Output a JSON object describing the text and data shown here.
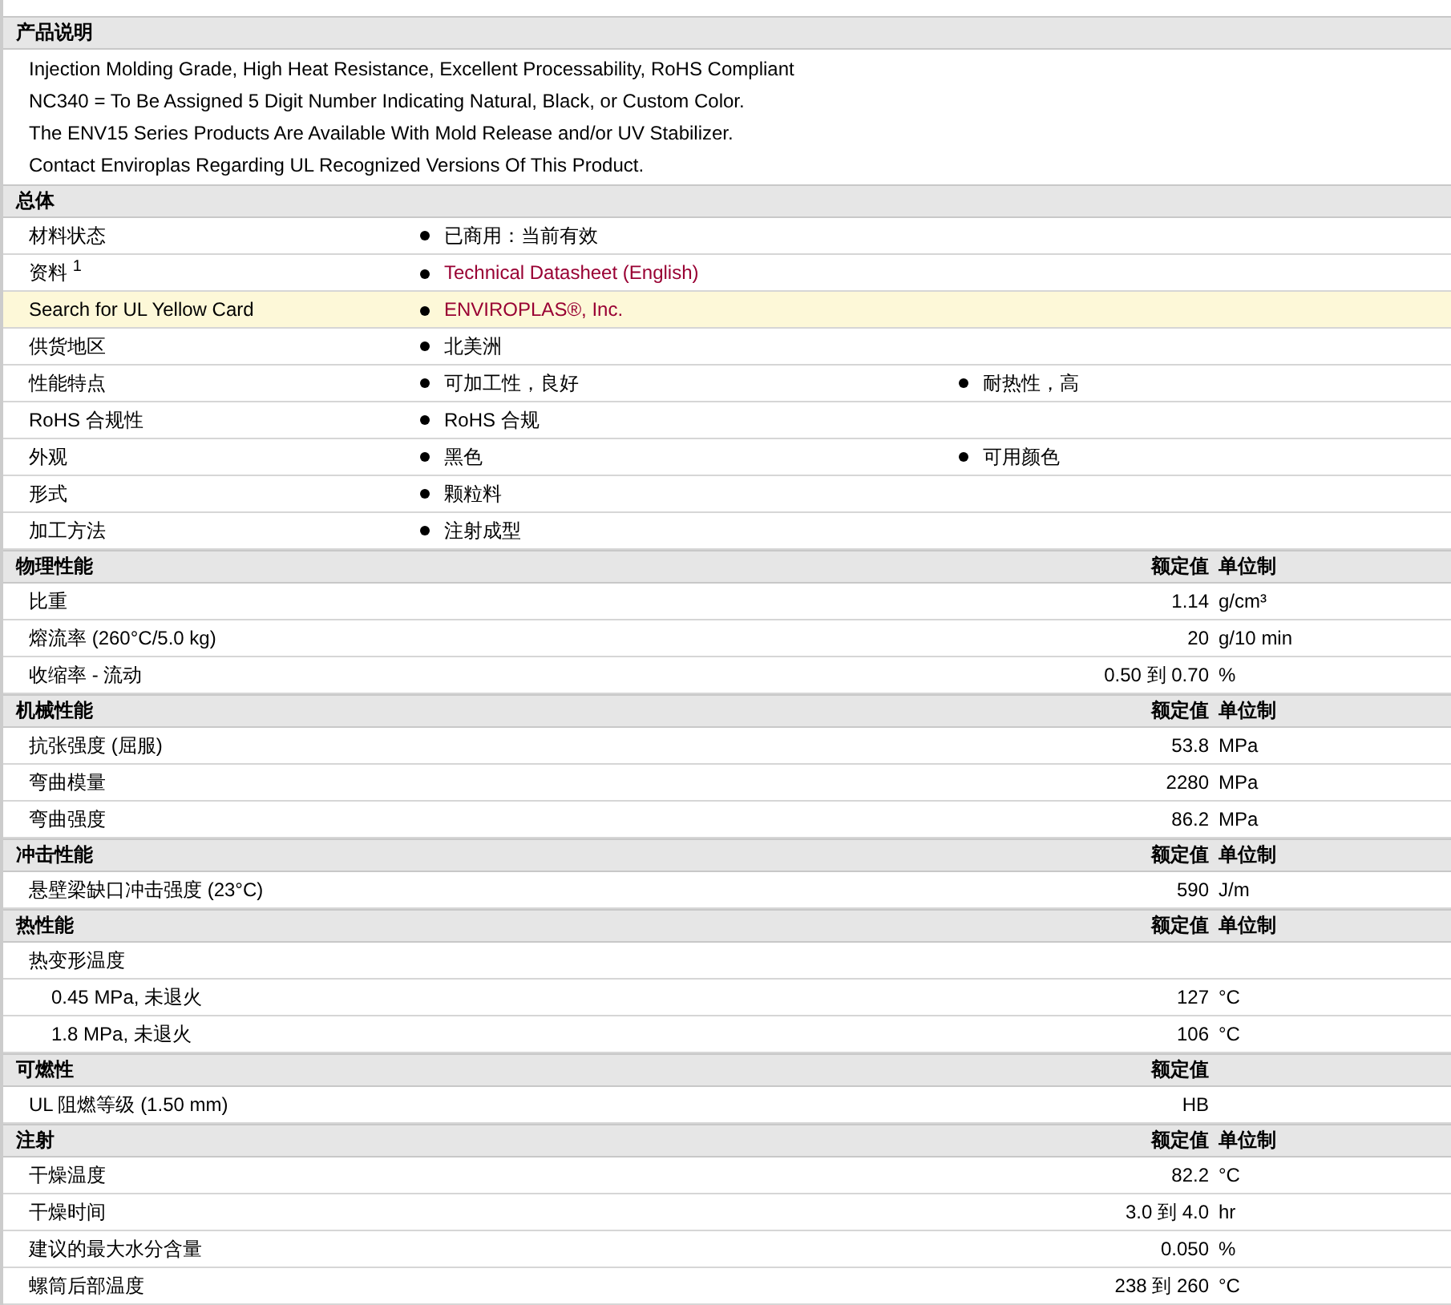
{
  "description": {
    "title": "产品说明",
    "lines": [
      "Injection Molding Grade, High Heat Resistance, Excellent Processability, RoHS Compliant",
      "NC340 = To Be Assigned 5 Digit Number Indicating Natural, Black, or Custom Color.",
      "The ENV15 Series Products Are Available With Mold Release and/or UV Stabilizer.",
      "Contact Enviroplas Regarding UL Recognized Versions Of This Product."
    ]
  },
  "general": {
    "title": "总体",
    "rows": [
      {
        "label": "材料状态",
        "highlighted": false,
        "values": [
          {
            "text": "已商用：当前有效",
            "kind": "text"
          }
        ]
      },
      {
        "label": "资料 $^{1}$",
        "highlighted": false,
        "values": [
          {
            "text": "Technical Datasheet (English)",
            "kind": "link"
          }
        ]
      },
      {
        "label": "Search for UL Yellow Card",
        "highlighted": true,
        "values": [
          {
            "text": "ENVIROPLAS®, Inc.",
            "kind": "link"
          }
        ]
      },
      {
        "label": "供货地区",
        "highlighted": false,
        "values": [
          {
            "text": "北美洲",
            "kind": "text"
          }
        ]
      },
      {
        "label": "性能特点",
        "highlighted": false,
        "values": [
          {
            "text": "可加工性，良好",
            "kind": "text"
          },
          {
            "text": "耐热性，高",
            "kind": "text"
          }
        ]
      },
      {
        "label": "RoHS 合规性",
        "highlighted": false,
        "values": [
          {
            "text": "RoHS 合规",
            "kind": "text"
          }
        ]
      },
      {
        "label": "外观",
        "highlighted": false,
        "values": [
          {
            "text": "黑色",
            "kind": "text"
          },
          {
            "text": "可用颜色",
            "kind": "text"
          }
        ]
      },
      {
        "label": "形式",
        "highlighted": false,
        "values": [
          {
            "text": "颗粒料",
            "kind": "text"
          }
        ]
      },
      {
        "label": "加工方法",
        "highlighted": false,
        "values": [
          {
            "text": "注射成型",
            "kind": "text"
          }
        ]
      }
    ]
  },
  "sections": [
    {
      "title": "物理性能",
      "value_header": "额定值",
      "unit_header": "单位制",
      "rows": [
        {
          "name": "比重",
          "value": "1.14",
          "unit": "g/cm³"
        },
        {
          "name": "熔流率  (260°C/5.0 kg)",
          "value": "20",
          "unit": "g/10 min"
        },
        {
          "name": "收缩率  - 流动",
          "value": "0.50 到  0.70",
          "unit": "%"
        }
      ]
    },
    {
      "title": "机械性能",
      "value_header": "额定值",
      "unit_header": "单位制",
      "rows": [
        {
          "name": "抗张强度  (屈服)",
          "value": "53.8",
          "unit": "MPa"
        },
        {
          "name": "弯曲模量",
          "value": "2280",
          "unit": "MPa"
        },
        {
          "name": "弯曲强度",
          "value": "86.2",
          "unit": "MPa"
        }
      ]
    },
    {
      "title": "冲击性能",
      "value_header": "额定值",
      "unit_header": "单位制",
      "rows": [
        {
          "name": "悬壁梁缺口冲击强度  (23°C)",
          "value": "590",
          "unit": "J/m"
        }
      ]
    },
    {
      "title": "热性能",
      "value_header": "额定值",
      "unit_header": "单位制",
      "rows": [
        {
          "name": "热变形温度",
          "children": [
            {
              "name": "0.45 MPa, 未退火",
              "value": "127",
              "unit": "°C"
            },
            {
              "name": "1.8 MPa, 未退火",
              "value": "106",
              "unit": "°C"
            }
          ]
        }
      ]
    },
    {
      "title": "可燃性",
      "value_header": "额定值",
      "rows": [
        {
          "name": "UL 阻燃等级  (1.50 mm)",
          "value": "HB"
        }
      ]
    },
    {
      "title": "注射",
      "value_header": "额定值",
      "unit_header": "单位制",
      "rows": [
        {
          "name": "干燥温度",
          "value": "82.2",
          "unit": "°C"
        },
        {
          "name": "干燥时间",
          "value": "3.0 到  4.0",
          "unit": "hr"
        },
        {
          "name": "建议的最大水分含量",
          "value": "0.050",
          "unit": "%"
        },
        {
          "name": "螺筒后部温度",
          "value": "238 到  260",
          "unit": "°C"
        }
      ]
    }
  ]
}
